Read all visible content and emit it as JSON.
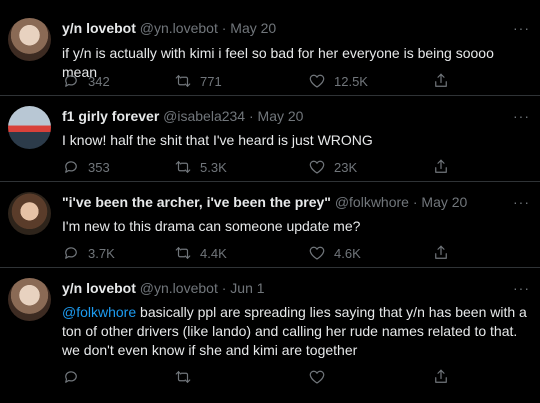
{
  "tweets": [
    {
      "name": "y/n lovebot",
      "handle": "@yn.lovebot",
      "dot": "·",
      "date": "May 20",
      "more": "···",
      "body": "if y/n is actually with kimi i feel so bad for her everyone is being soooo mean",
      "mention": "",
      "replies": "342",
      "retweets": "771",
      "likes": "12.5K"
    },
    {
      "name": "f1 girly forever",
      "handle": "@isabela234",
      "dot": "·",
      "date": "May 20",
      "more": "···",
      "body": "I know! half the shit that I've heard is just WRONG",
      "mention": "",
      "replies": "353",
      "retweets": "5.3K",
      "likes": "23K"
    },
    {
      "name": "\"i've been the archer, i've been the prey\"",
      "handle": "@folkwhore",
      "dot": "·",
      "date": "May 20",
      "more": "···",
      "body": "I'm new to this drama can someone update me?",
      "mention": "",
      "replies": "3.7K",
      "retweets": "4.4K",
      "likes": "4.6K"
    },
    {
      "name": "y/n lovebot",
      "handle": "@yn.lovebot",
      "dot": "·",
      "date": "Jun 1",
      "more": "···",
      "mention": "@folkwhore",
      "body": " basically ppl are spreading lies saying that y/n has been with a ton of other drivers (like lando) and calling her rude names related to that. we don't even know if she and kimi are together",
      "replies": "",
      "retweets": "",
      "likes": ""
    }
  ],
  "colors": {
    "background": "#000000",
    "text": "#e7e9ea",
    "muted": "#71767b",
    "link": "#1d9bf0",
    "divider": "#2f3336"
  },
  "icons": [
    "reply-icon",
    "retweet-icon",
    "like-icon",
    "share-icon"
  ]
}
